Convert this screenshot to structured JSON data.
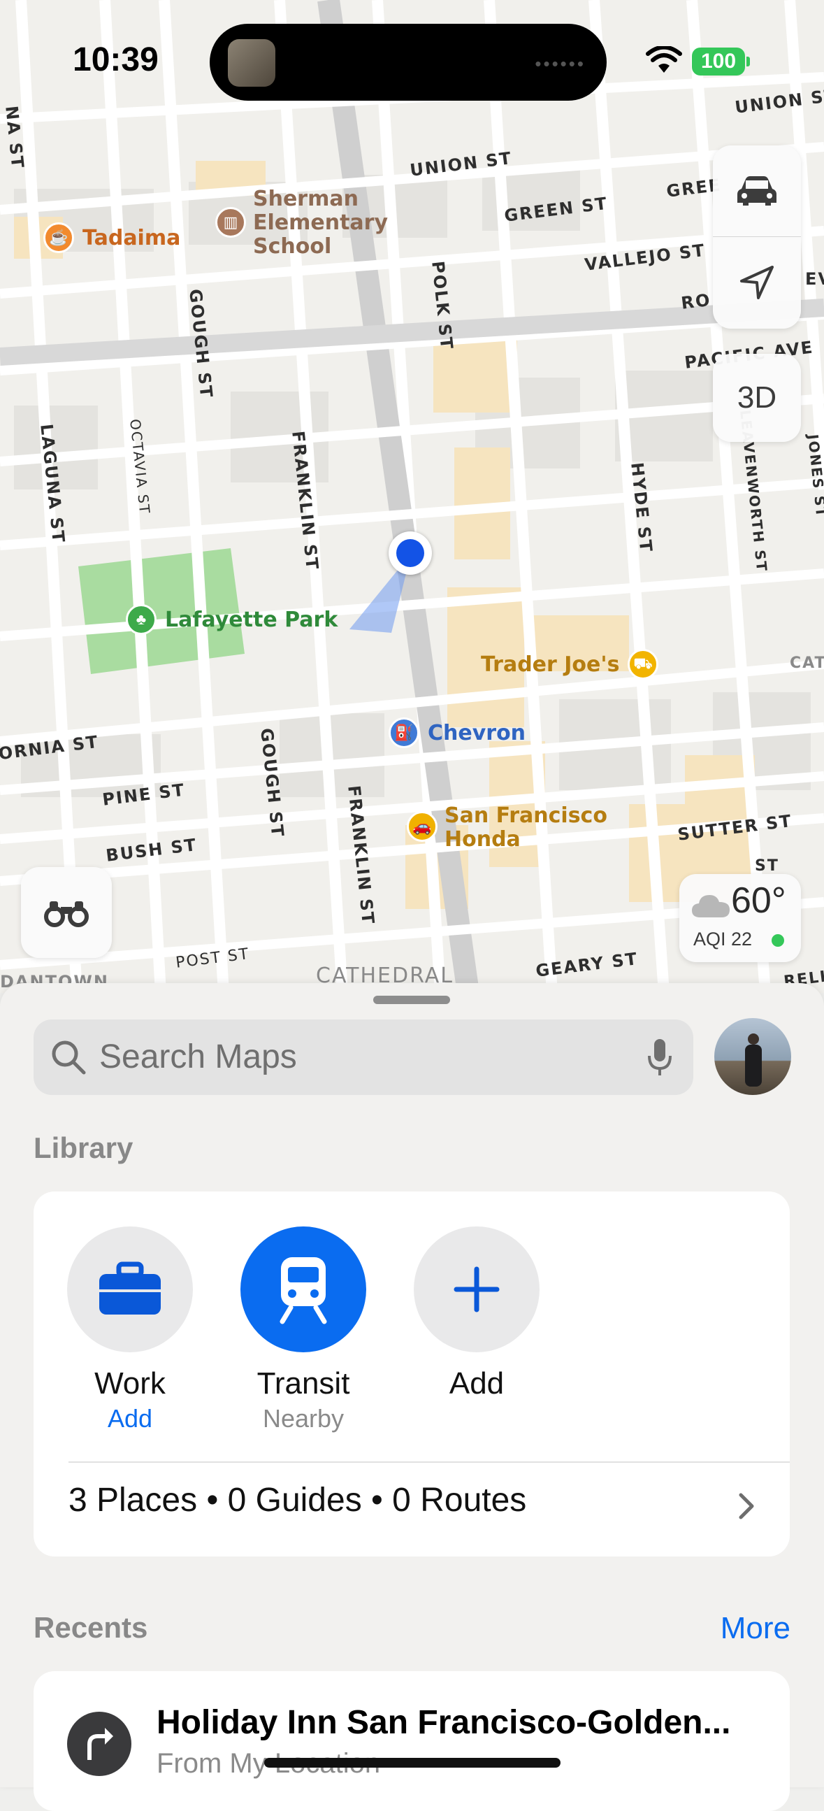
{
  "status_bar": {
    "time": "10:39",
    "battery": "100"
  },
  "map": {
    "streets": [
      "UNION ST",
      "UNION ST",
      "GREEN ST",
      "GREE",
      "VALLEJO ST",
      "RO",
      "PACIFIC AVE",
      "GOUGH ST",
      "OCTAVIA ST",
      "LAGUNA ST",
      "FRANKLIN ST",
      "POLK ST",
      "HYDE ST",
      "LEAVENWORTH ST",
      "JONES ST",
      "CALIFORNIA ST",
      "PINE ST",
      "BUSH ST",
      "SUTTER ST",
      "GOUGH ST",
      "FRANKLIN ST",
      "POST ST",
      "GEARY ST",
      "DANTOWN",
      "CATHEDRAL",
      "NA ST",
      "EV",
      "CAT",
      "RELL S",
      "ST"
    ],
    "pois": [
      {
        "name": "Tadaima",
        "icon": "cafe-icon"
      },
      {
        "name": "Sherman\nElementary\nSchool",
        "icon": "school-icon"
      },
      {
        "name": "Lafayette Park",
        "icon": "park-icon"
      },
      {
        "name": "Trader Joe's",
        "icon": "grocery-icon"
      },
      {
        "name": "Chevron",
        "icon": "fuel-icon"
      },
      {
        "name": "San Francisco\nHonda",
        "icon": "car-dealer-icon"
      }
    ],
    "controls": {
      "view_3d": "3D"
    },
    "weather": {
      "temperature": "60°",
      "aqi": "AQI 22"
    }
  },
  "sheet": {
    "search_placeholder": "Search Maps",
    "library_title": "Library",
    "library_items": [
      {
        "label": "Work",
        "sublabel": "Add",
        "icon": "briefcase-icon"
      },
      {
        "label": "Transit",
        "sublabel": "Nearby",
        "icon": "train-icon"
      },
      {
        "label": "Add",
        "sublabel": "",
        "icon": "plus-icon"
      }
    ],
    "library_summary": "3 Places • 0 Guides • 0 Routes",
    "recents_title": "Recents",
    "recents_more": "More",
    "recents": [
      {
        "title": "Holiday Inn San Francisco-Golden...",
        "subtitle": "From My Location",
        "icon": "turn-right-icon"
      }
    ]
  },
  "colors": {
    "accent": "#0a6cf0",
    "location_dot": "#1353e6",
    "park": "#9fd48e"
  }
}
